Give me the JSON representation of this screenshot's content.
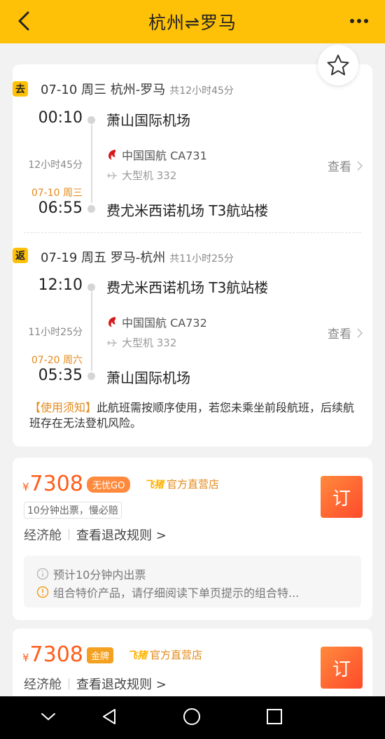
{
  "header": {
    "title": "杭州⇌罗马"
  },
  "outbound": {
    "tag": "去",
    "date": "07-10 周三 杭州-罗马",
    "total_duration": "共12小时45分",
    "dep_time": "00:10",
    "dep_airport": "萧山国际机场",
    "fly_duration": "12小时45分",
    "airline": "中国国航 CA731",
    "aircraft": "大型机 332",
    "view_label": "查看",
    "arr_date": "07-10 周三",
    "arr_time": "06:55",
    "arr_airport": "费尤米西诺机场 T3航站楼"
  },
  "return": {
    "tag": "返",
    "date": "07-19 周五 罗马-杭州",
    "total_duration": "共11小时25分",
    "dep_time": "12:10",
    "dep_airport": "费尤米西诺机场 T3航站楼",
    "fly_duration": "11小时25分",
    "airline": "中国国航 CA732",
    "aircraft": "大型机 332",
    "view_label": "查看",
    "arr_date": "07-20 周六",
    "arr_time": "05:35",
    "arr_airport": "萧山国际机场"
  },
  "notice": {
    "title": "【使用须知】",
    "text": "此航班需按顺序使用，若您未乘坐前段航班，后续航班存在无法登机风险。"
  },
  "offers": [
    {
      "currency": "¥",
      "price": "7308",
      "badge": "无忧GO",
      "store_logo": "飞猪",
      "store": "官方直营店",
      "note": "10分钟出票，慢必赔",
      "cabin": "经济舱",
      "rule": "查看退改规则 >",
      "book_label": "订",
      "tip1": "预计10分钟内出票",
      "tip2": "组合特价产品，请仔细阅读下单页提示的组合特..."
    },
    {
      "currency": "¥",
      "price": "7308",
      "badge": "金牌",
      "store_logo": "飞猪",
      "store": "官方直营店",
      "cabin": "经济舱",
      "rule": "查看退改规则 >",
      "book_label": "订"
    }
  ],
  "colors": {
    "header": "#ffc107",
    "price": "#ff5d1b",
    "accent": "#e38a1c",
    "airline_logo": "#d7191c"
  }
}
